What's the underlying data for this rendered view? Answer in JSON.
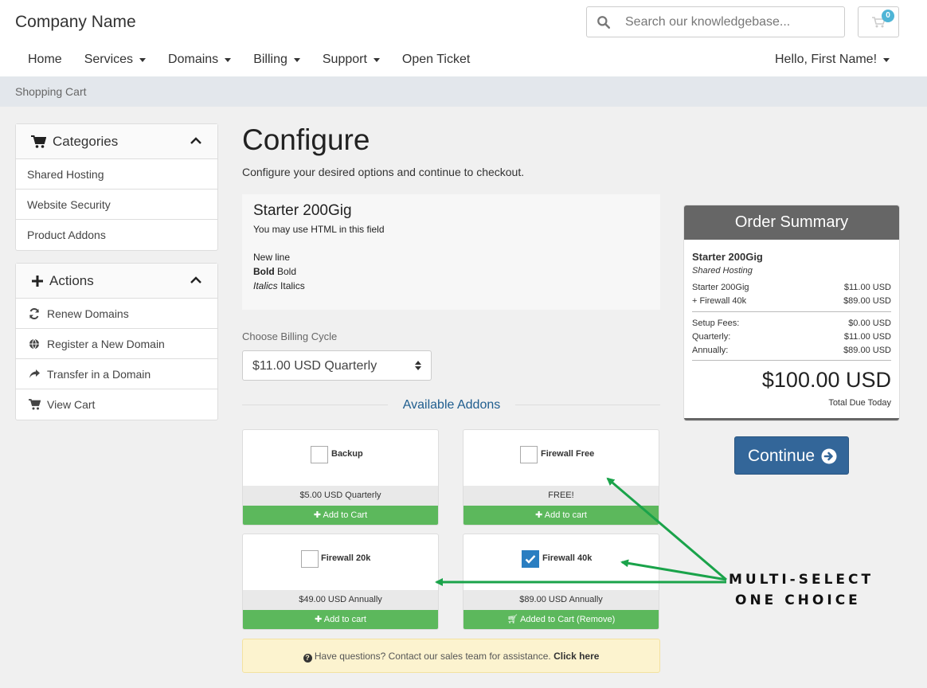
{
  "header": {
    "company": "Company Name",
    "search_placeholder": "Search our knowledgebase...",
    "cart_count": "0"
  },
  "nav": {
    "items": [
      "Home",
      "Services",
      "Domains",
      "Billing",
      "Support",
      "Open Ticket"
    ],
    "user": "Hello, First Name!"
  },
  "breadcrumb": "Shopping Cart",
  "sidebar": {
    "categories_title": "Categories",
    "categories": [
      "Shared Hosting",
      "Website Security",
      "Product Addons"
    ],
    "actions_title": "Actions",
    "actions": [
      "Renew Domains",
      "Register a New Domain",
      "Transfer in a Domain",
      "View Cart"
    ]
  },
  "main": {
    "title": "Configure",
    "subtitle": "Configure your desired options and continue to checkout.",
    "product": {
      "name": "Starter 200Gig",
      "line1": "You may use HTML in this field",
      "line2": "New line",
      "bold_label": "Bold",
      "bold_text": " Bold",
      "italic_label": "Italics",
      "italic_text": " Italics"
    },
    "billing_label": "Choose Billing Cycle",
    "billing_value": "$11.00 USD Quarterly",
    "addons_title": "Available Addons",
    "addons": [
      {
        "name": "Backup",
        "price": "$5.00 USD Quarterly",
        "button": "Add to Cart",
        "checked": false
      },
      {
        "name": "Firewall Free",
        "price": "FREE!",
        "button": "Add to cart",
        "checked": false
      },
      {
        "name": "Firewall 20k",
        "price": "$49.00 USD Annually",
        "button": "Add to cart",
        "checked": false
      },
      {
        "name": "Firewall 40k",
        "price": "$89.00 USD Annually",
        "button": "Added to Cart (Remove)",
        "checked": true
      }
    ],
    "help_text": "Have questions? Contact our sales team for assistance.",
    "help_link": "Click here"
  },
  "summary": {
    "title": "Order Summary",
    "product": "Starter 200Gig",
    "group": "Shared Hosting",
    "lines": [
      {
        "label": "Starter 200Gig",
        "value": "$11.00 USD"
      },
      {
        "label": "+ Firewall 40k",
        "value": "$89.00 USD"
      }
    ],
    "fees": [
      {
        "label": "Setup Fees:",
        "value": "$0.00 USD"
      },
      {
        "label": "Quarterly:",
        "value": "$11.00 USD"
      },
      {
        "label": "Annually:",
        "value": "$89.00 USD"
      }
    ],
    "total": "$100.00 USD",
    "total_label": "Total Due Today",
    "continue": "Continue"
  },
  "annotation": {
    "line1": "MULTI-SELECT",
    "line2": "ONE CHOICE",
    "color": "#1aa34a"
  }
}
